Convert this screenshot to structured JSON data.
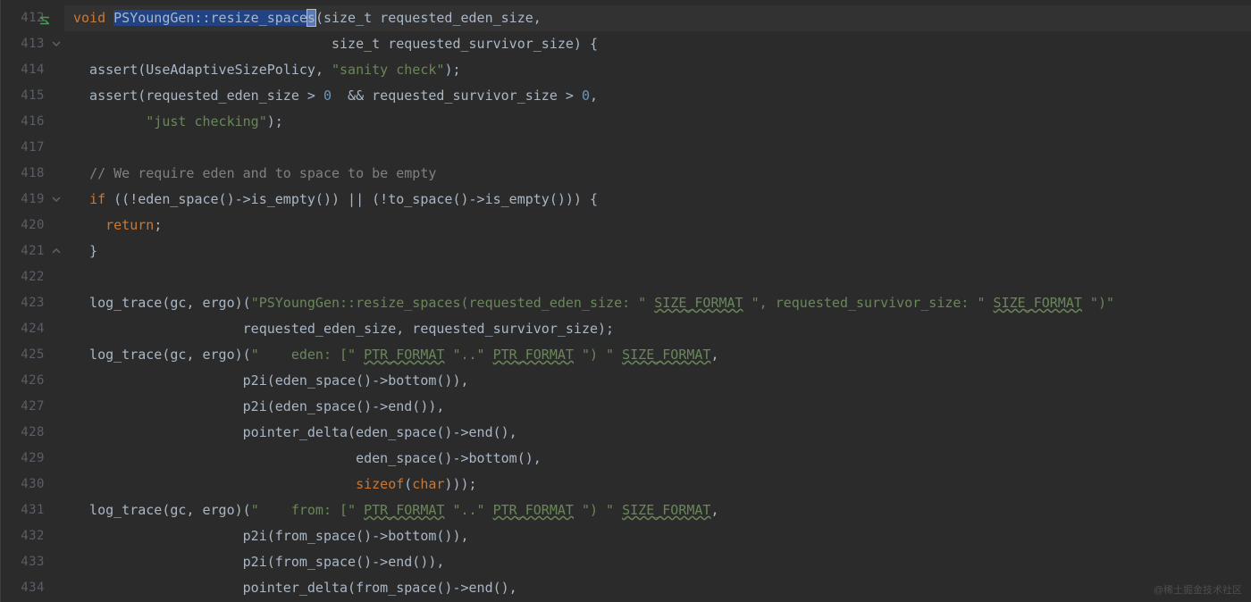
{
  "watermark": "@稀土掘金技术社区",
  "lines": [
    {
      "num": "412",
      "vcs": true,
      "fold": "none",
      "hl": true,
      "tokens": [
        [
          "kw",
          "void "
        ],
        [
          "sel",
          "PSYoungGen"
        ],
        [
          "sel",
          "::"
        ],
        [
          "sel",
          "resize_space"
        ],
        [
          "cursor",
          "s"
        ],
        [
          "pl",
          "("
        ],
        [
          "pl",
          "size_t requested_eden_size"
        ],
        [
          "pl",
          ","
        ]
      ]
    },
    {
      "num": "413",
      "fold": "down",
      "tokens": [
        [
          "pl",
          "                                size_t requested_survivor_size) {"
        ]
      ]
    },
    {
      "num": "414",
      "tokens": [
        [
          "pl",
          "  assert(UseAdaptiveSizePolicy"
        ],
        [
          "pl",
          ", "
        ],
        [
          "str",
          "\"sanity check\""
        ],
        [
          "pl",
          ");"
        ]
      ]
    },
    {
      "num": "415",
      "tokens": [
        [
          "pl",
          "  assert(requested_eden_size > "
        ],
        [
          "num",
          "0"
        ],
        [
          "pl",
          "  && requested_survivor_size > "
        ],
        [
          "num",
          "0"
        ],
        [
          "pl",
          ","
        ]
      ]
    },
    {
      "num": "416",
      "tokens": [
        [
          "pl",
          "         "
        ],
        [
          "str",
          "\"just checking\""
        ],
        [
          "pl",
          ");"
        ]
      ]
    },
    {
      "num": "417",
      "tokens": [
        [
          "pl",
          ""
        ]
      ]
    },
    {
      "num": "418",
      "tokens": [
        [
          "pl",
          "  "
        ],
        [
          "cm",
          "// We require eden and to space to be empty"
        ]
      ]
    },
    {
      "num": "419",
      "fold": "down",
      "tokens": [
        [
          "pl",
          "  "
        ],
        [
          "kw",
          "if"
        ],
        [
          "pl",
          " ((!eden_space()->is_empty()) || (!to_space()->is_empty())) {"
        ]
      ]
    },
    {
      "num": "420",
      "tokens": [
        [
          "pl",
          "    "
        ],
        [
          "kw",
          "return"
        ],
        [
          "pl",
          ";"
        ]
      ]
    },
    {
      "num": "421",
      "fold": "up",
      "tokens": [
        [
          "pl",
          "  }"
        ]
      ]
    },
    {
      "num": "422",
      "tokens": [
        [
          "pl",
          ""
        ]
      ]
    },
    {
      "num": "423",
      "tokens": [
        [
          "pl",
          "  log_trace(gc"
        ],
        [
          "pl",
          ", "
        ],
        [
          "pl",
          "ergo)"
        ],
        [
          "pl",
          "("
        ],
        [
          "str",
          "\"PSYoungGen::resize_spaces(requested_eden_size: \""
        ],
        [
          "pl",
          " "
        ],
        [
          "strl",
          "SIZE_FORMAT"
        ],
        [
          "pl",
          " "
        ],
        [
          "str",
          "\", requested_survivor_size: \""
        ],
        [
          "pl",
          " "
        ],
        [
          "strl",
          "SIZE_FORMAT"
        ],
        [
          "pl",
          " "
        ],
        [
          "str",
          "\")\""
        ]
      ]
    },
    {
      "num": "424",
      "tokens": [
        [
          "pl",
          "                     requested_eden_size"
        ],
        [
          "pl",
          ", "
        ],
        [
          "pl",
          "requested_survivor_size);"
        ]
      ]
    },
    {
      "num": "425",
      "tokens": [
        [
          "pl",
          "  log_trace(gc"
        ],
        [
          "pl",
          ", "
        ],
        [
          "pl",
          "ergo)"
        ],
        [
          "pl",
          "("
        ],
        [
          "str",
          "\"    eden: [\""
        ],
        [
          "pl",
          " "
        ],
        [
          "strl",
          "PTR_FORMAT"
        ],
        [
          "pl",
          " "
        ],
        [
          "str",
          "\"..\""
        ],
        [
          "pl",
          " "
        ],
        [
          "strl",
          "PTR_FORMAT"
        ],
        [
          "pl",
          " "
        ],
        [
          "str",
          "\") \""
        ],
        [
          "pl",
          " "
        ],
        [
          "strl",
          "SIZE_FORMAT"
        ],
        [
          "pl",
          ","
        ]
      ]
    },
    {
      "num": "426",
      "tokens": [
        [
          "pl",
          "                     p2i(eden_space()->bottom())"
        ],
        [
          "pl",
          ","
        ]
      ]
    },
    {
      "num": "427",
      "tokens": [
        [
          "pl",
          "                     p2i(eden_space()->end())"
        ],
        [
          "pl",
          ","
        ]
      ]
    },
    {
      "num": "428",
      "tokens": [
        [
          "pl",
          "                     pointer_delta(eden_space()->end()"
        ],
        [
          "pl",
          ","
        ]
      ]
    },
    {
      "num": "429",
      "tokens": [
        [
          "pl",
          "                                   eden_space()->bottom()"
        ],
        [
          "pl",
          ","
        ]
      ]
    },
    {
      "num": "430",
      "tokens": [
        [
          "pl",
          "                                   "
        ],
        [
          "kw",
          "sizeof"
        ],
        [
          "pl",
          "("
        ],
        [
          "kw",
          "char"
        ],
        [
          "pl",
          ")));"
        ]
      ]
    },
    {
      "num": "431",
      "tokens": [
        [
          "pl",
          "  log_trace(gc"
        ],
        [
          "pl",
          ", "
        ],
        [
          "pl",
          "ergo)"
        ],
        [
          "pl",
          "("
        ],
        [
          "str",
          "\"    from: [\""
        ],
        [
          "pl",
          " "
        ],
        [
          "strl",
          "PTR_FORMAT"
        ],
        [
          "pl",
          " "
        ],
        [
          "str",
          "\"..\""
        ],
        [
          "pl",
          " "
        ],
        [
          "strl",
          "PTR_FORMAT"
        ],
        [
          "pl",
          " "
        ],
        [
          "str",
          "\") \""
        ],
        [
          "pl",
          " "
        ],
        [
          "strl",
          "SIZE_FORMAT"
        ],
        [
          "pl",
          ","
        ]
      ]
    },
    {
      "num": "432",
      "tokens": [
        [
          "pl",
          "                     p2i(from_space()->bottom())"
        ],
        [
          "pl",
          ","
        ]
      ]
    },
    {
      "num": "433",
      "tokens": [
        [
          "pl",
          "                     p2i(from_space()->end())"
        ],
        [
          "pl",
          ","
        ]
      ]
    },
    {
      "num": "434",
      "tokens": [
        [
          "pl",
          "                     pointer_delta(from_space()->end()"
        ],
        [
          "pl",
          ","
        ]
      ]
    }
  ]
}
